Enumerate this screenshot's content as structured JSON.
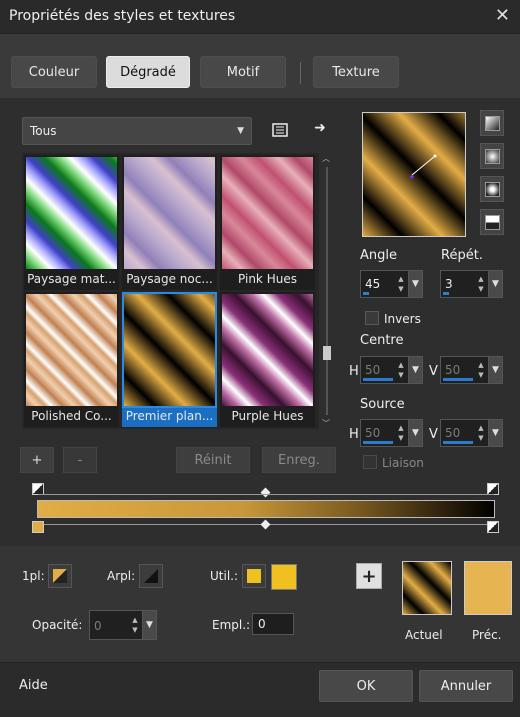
{
  "window": {
    "title": "Propriétés des styles et textures"
  },
  "tabs": [
    {
      "label": "Couleur"
    },
    {
      "label": "Dégradé"
    },
    {
      "label": "Motif"
    },
    {
      "label": "Texture"
    }
  ],
  "category": {
    "selected": "Tous"
  },
  "gradients": [
    {
      "label": "Paysage mat..."
    },
    {
      "label": "Paysage noc..."
    },
    {
      "label": "Pink Hues"
    },
    {
      "label": "Polished Co..."
    },
    {
      "label": "Premier plan..."
    },
    {
      "label": "Purple Hues"
    }
  ],
  "list_buttons": {
    "add": "+",
    "remove": "-",
    "reset": "Réinit",
    "save": "Enreg."
  },
  "angle": {
    "label": "Angle",
    "value": "45"
  },
  "repeat": {
    "label": "Répét.",
    "value": "3"
  },
  "invert": {
    "label": "Invers"
  },
  "centre": {
    "label": "Centre",
    "h_label": "H",
    "h_value": "50",
    "v_label": "V",
    "v_value": "50"
  },
  "source": {
    "label": "Source",
    "h_label": "H",
    "h_value": "50",
    "v_label": "V",
    "v_value": "50"
  },
  "link": {
    "label": "Liaison"
  },
  "stops": {
    "fg_label": "1pl:",
    "bg_label": "Arpl:",
    "user_label": "Util.:",
    "opacity_label": "Opacité:",
    "opacity_value": "0",
    "location_label": "Empl.:",
    "location_value": "0"
  },
  "swatches": {
    "current_label": "Actuel",
    "previous_label": "Préc.",
    "add": "+"
  },
  "footer": {
    "help": "Aide",
    "ok": "OK",
    "cancel": "Annuler"
  },
  "colors": {
    "accent": "#1a6fc2",
    "gold": "#e2ad46",
    "user": "#f0c020"
  }
}
